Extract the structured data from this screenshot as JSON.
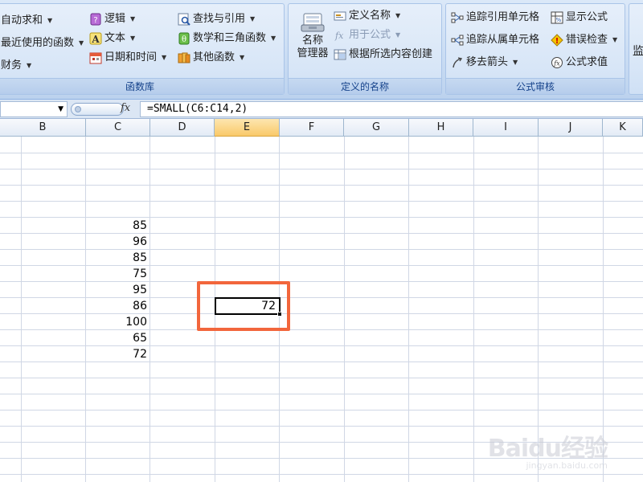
{
  "ribbon": {
    "function_library": {
      "label": "函数库",
      "items": [
        {
          "label": "自动求和",
          "icon": "sum-icon"
        },
        {
          "label": "最近使用的函数",
          "icon": "recent-icon"
        },
        {
          "label": "财务",
          "icon": "finance-icon"
        },
        {
          "label": "逻辑",
          "icon": "logic-icon"
        },
        {
          "label": "文本",
          "icon": "text-icon"
        },
        {
          "label": "日期和时间",
          "icon": "calendar-icon"
        },
        {
          "label": "查找与引用",
          "icon": "lookup-icon"
        },
        {
          "label": "数学和三角函数",
          "icon": "math-icon"
        },
        {
          "label": "其他函数",
          "icon": "more-functions-icon"
        }
      ]
    },
    "defined_names": {
      "label": "定义的名称",
      "name_manager_line1": "名称",
      "name_manager_line2": "管理器",
      "define_name": "定义名称",
      "use_in_formula": "用于公式",
      "create_from_selection": "根据所选内容创建"
    },
    "formula_auditing": {
      "label": "公式审核",
      "trace_precedents": "追踪引用单元格",
      "trace_dependents": "追踪从属单元格",
      "remove_arrows": "移去箭头",
      "show_formulas": "显示公式",
      "error_checking": "错误检查",
      "evaluate_formula": "公式求值",
      "watch_window_partial": "监"
    }
  },
  "formula_bar": {
    "fx": "fx",
    "formula": "=SMALL(C6:C14,2)"
  },
  "columns": [
    "B",
    "C",
    "D",
    "E",
    "F",
    "G",
    "H",
    "I",
    "J",
    "K"
  ],
  "selected_column": "E",
  "column_c_values": [
    "85",
    "96",
    "85",
    "75",
    "95",
    "86",
    "100",
    "65",
    "72"
  ],
  "active_cell_value": "72",
  "watermark": {
    "logo": "Baidu经验",
    "url": "jingyan.baidu.com"
  },
  "colors": {
    "highlight": "#f2663c",
    "selected_header": "#f9c96a"
  }
}
